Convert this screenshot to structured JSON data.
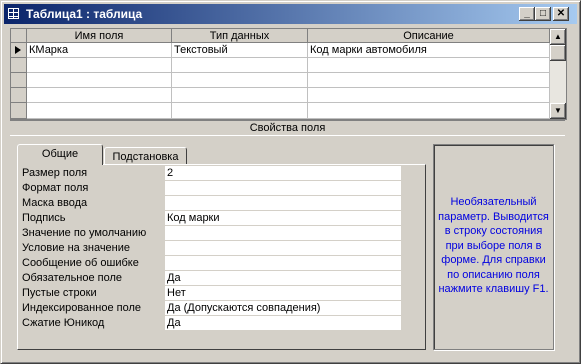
{
  "window": {
    "title": "Таблица1 : таблица",
    "icon": "table-icon",
    "controls": {
      "minimize": "_",
      "maximize": "□",
      "close": "✕"
    }
  },
  "field_grid": {
    "columns": [
      "Имя поля",
      "Тип данных",
      "Описание"
    ],
    "rows": [
      {
        "name": "КМарка",
        "type": "Текстовый",
        "description": "Код марки автомобиля",
        "current": true
      }
    ],
    "scroll": {
      "up": "▲",
      "down": "▼"
    }
  },
  "field_properties": {
    "title": "Свойства поля",
    "tabs": [
      "Общие",
      "Подстановка"
    ],
    "active_tab": "Общие",
    "items": [
      {
        "label": "Размер поля",
        "value": "2"
      },
      {
        "label": "Формат поля",
        "value": ""
      },
      {
        "label": "Маска ввода",
        "value": ""
      },
      {
        "label": "Подпись",
        "value": "Код марки"
      },
      {
        "label": "Значение по умолчанию",
        "value": ""
      },
      {
        "label": "Условие на значение",
        "value": ""
      },
      {
        "label": "Сообщение об ошибке",
        "value": ""
      },
      {
        "label": "Обязательное поле",
        "value": "Да"
      },
      {
        "label": "Пустые строки",
        "value": "Нет"
      },
      {
        "label": "Индексированное поле",
        "value": "Да (Допускаются совпадения)"
      },
      {
        "label": "Сжатие Юникод",
        "value": "Да"
      }
    ]
  },
  "hint": {
    "text": "Необязательный параметр. Выводится в строку состояния при выборе поля в форме.  Для справки по описанию поля нажмите клавишу F1.",
    "color": "#0000e0"
  },
  "colors": {
    "title_bar_start": "#0a246a",
    "title_bar_end": "#a6caf0",
    "face": "#d4d0c8",
    "desktop": "#808080"
  }
}
